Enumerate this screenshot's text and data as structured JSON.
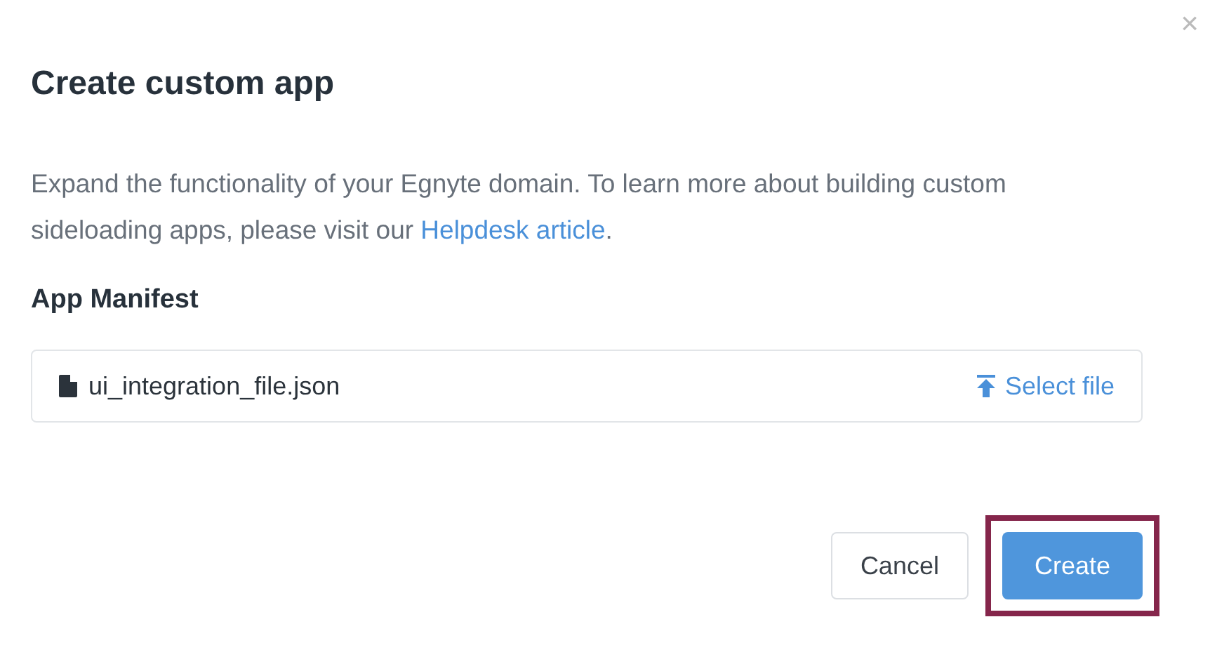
{
  "dialog": {
    "title": "Create custom app",
    "close": "×"
  },
  "description": {
    "text": "Expand the functionality of your Egnyte domain. To learn more about building custom sideloading apps, please visit our ",
    "link": "Helpdesk article",
    "after": "."
  },
  "manifest": {
    "label": "App Manifest",
    "file_name": "ui_integration_file.json",
    "select_label": "Select file"
  },
  "buttons": [
    {
      "label": "Cancel",
      "kind": "secondary",
      "highlighted": false
    },
    {
      "label": "Create",
      "kind": "primary",
      "highlighted": true
    }
  ]
}
